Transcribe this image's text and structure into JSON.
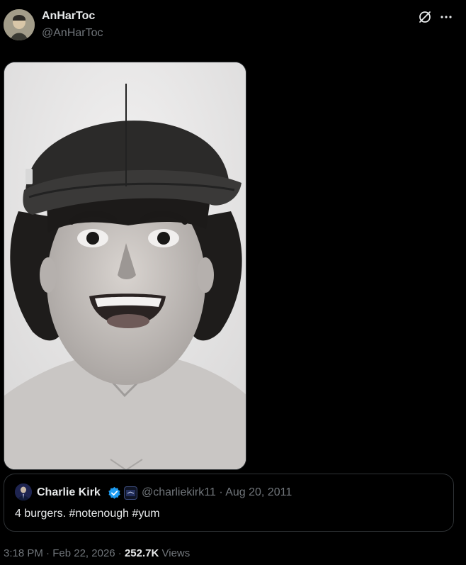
{
  "author": {
    "display_name": "AnHarToc",
    "handle": "@AnHarToc",
    "avatar_icon": "user-avatar"
  },
  "actions": {
    "grok_icon": "grok-icon",
    "more_icon": "more-horizontal-icon"
  },
  "media": {
    "icon": "photo-portrait-grayscale"
  },
  "quote": {
    "display_name": "Charlie Kirk",
    "verified_icon": "verified-badge-icon",
    "verified_color": "#1d9bf0",
    "affiliation_icon": "affiliate-badge-icon",
    "handle": "@charliekirk11",
    "separator": "·",
    "date": "Aug 20, 2011",
    "text": "4 burgers. #notenough #yum"
  },
  "footer": {
    "time": "3:18 PM",
    "separator1": "·",
    "date": "Feb 22, 2026",
    "separator2": "·",
    "views_count": "252.7K",
    "views_label": "Views"
  },
  "colors": {
    "background": "#000000",
    "primary_text": "#e7e9ea",
    "secondary_text": "#71767b",
    "border": "#2f3336",
    "accent": "#1d9bf0"
  }
}
